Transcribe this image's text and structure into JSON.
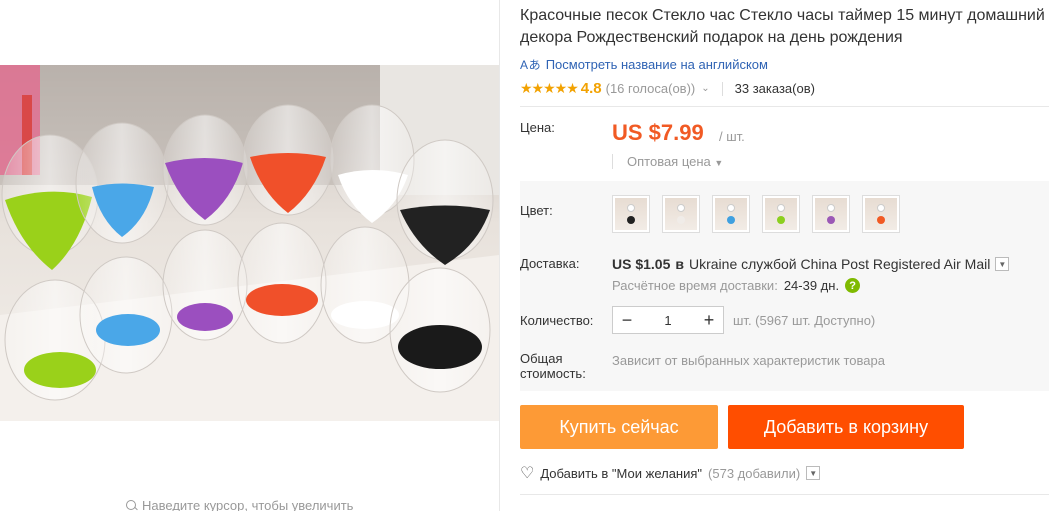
{
  "gallery": {
    "zoom_hint": "Наведите курсор, чтобы увеличить"
  },
  "product": {
    "title": "Красочные песок Стекло час Стекло часы таймер 15 минут домашний декора Рождественский подарок на день рождения",
    "translate_link": "Посмотреть название на английском",
    "translate_icon": "translate-icon",
    "rating": {
      "stars": "★★★★★",
      "value": "4.8",
      "votes": "(16 голоса(ов))",
      "orders": "33 заказа(ов)",
      "stars_filled": 4.8
    }
  },
  "price": {
    "label": "Цена:",
    "value": "US $7.99",
    "unit": "/ шт.",
    "wholesale": "Оптовая цена"
  },
  "color": {
    "label": "Цвет:",
    "swatches": [
      {
        "top": "#ffffff",
        "bottom": "#222222"
      },
      {
        "top": "#ffffff",
        "bottom": "#f0ece8"
      },
      {
        "top": "#ffffff",
        "bottom": "#3fa0e0"
      },
      {
        "top": "#ffffff",
        "bottom": "#8ccf1f"
      },
      {
        "top": "#ffffff",
        "bottom": "#9b59b6"
      },
      {
        "top": "#ffffff",
        "bottom": "#f15a24"
      }
    ]
  },
  "shipping": {
    "label": "Доставка:",
    "price": "US $1.05",
    "prefix": "в",
    "destination": "Ukraine службой China Post Registered Air Mail",
    "est_label": "Расчётное время доставки:",
    "est_days": "24-39 дн.",
    "help_icon": "?"
  },
  "quantity": {
    "label": "Количество:",
    "minus": "−",
    "value": "1",
    "plus": "+",
    "available": "шт. (5967 шт. Доступно)"
  },
  "total": {
    "label": "Общая стоимость:",
    "value": "Зависит от выбранных характеристик товара"
  },
  "actions": {
    "buy_now": "Купить сейчас",
    "add_to_cart": "Добавить в корзину",
    "wishlist": "Добавить в \"Мои желания\"",
    "wishlist_count": "(573 добавили)"
  },
  "colors": {
    "accent": "#ff4e00",
    "buy": "#fd9a36",
    "price": "#f15a24",
    "stars": "#f2a202",
    "link": "#2f63b4"
  }
}
